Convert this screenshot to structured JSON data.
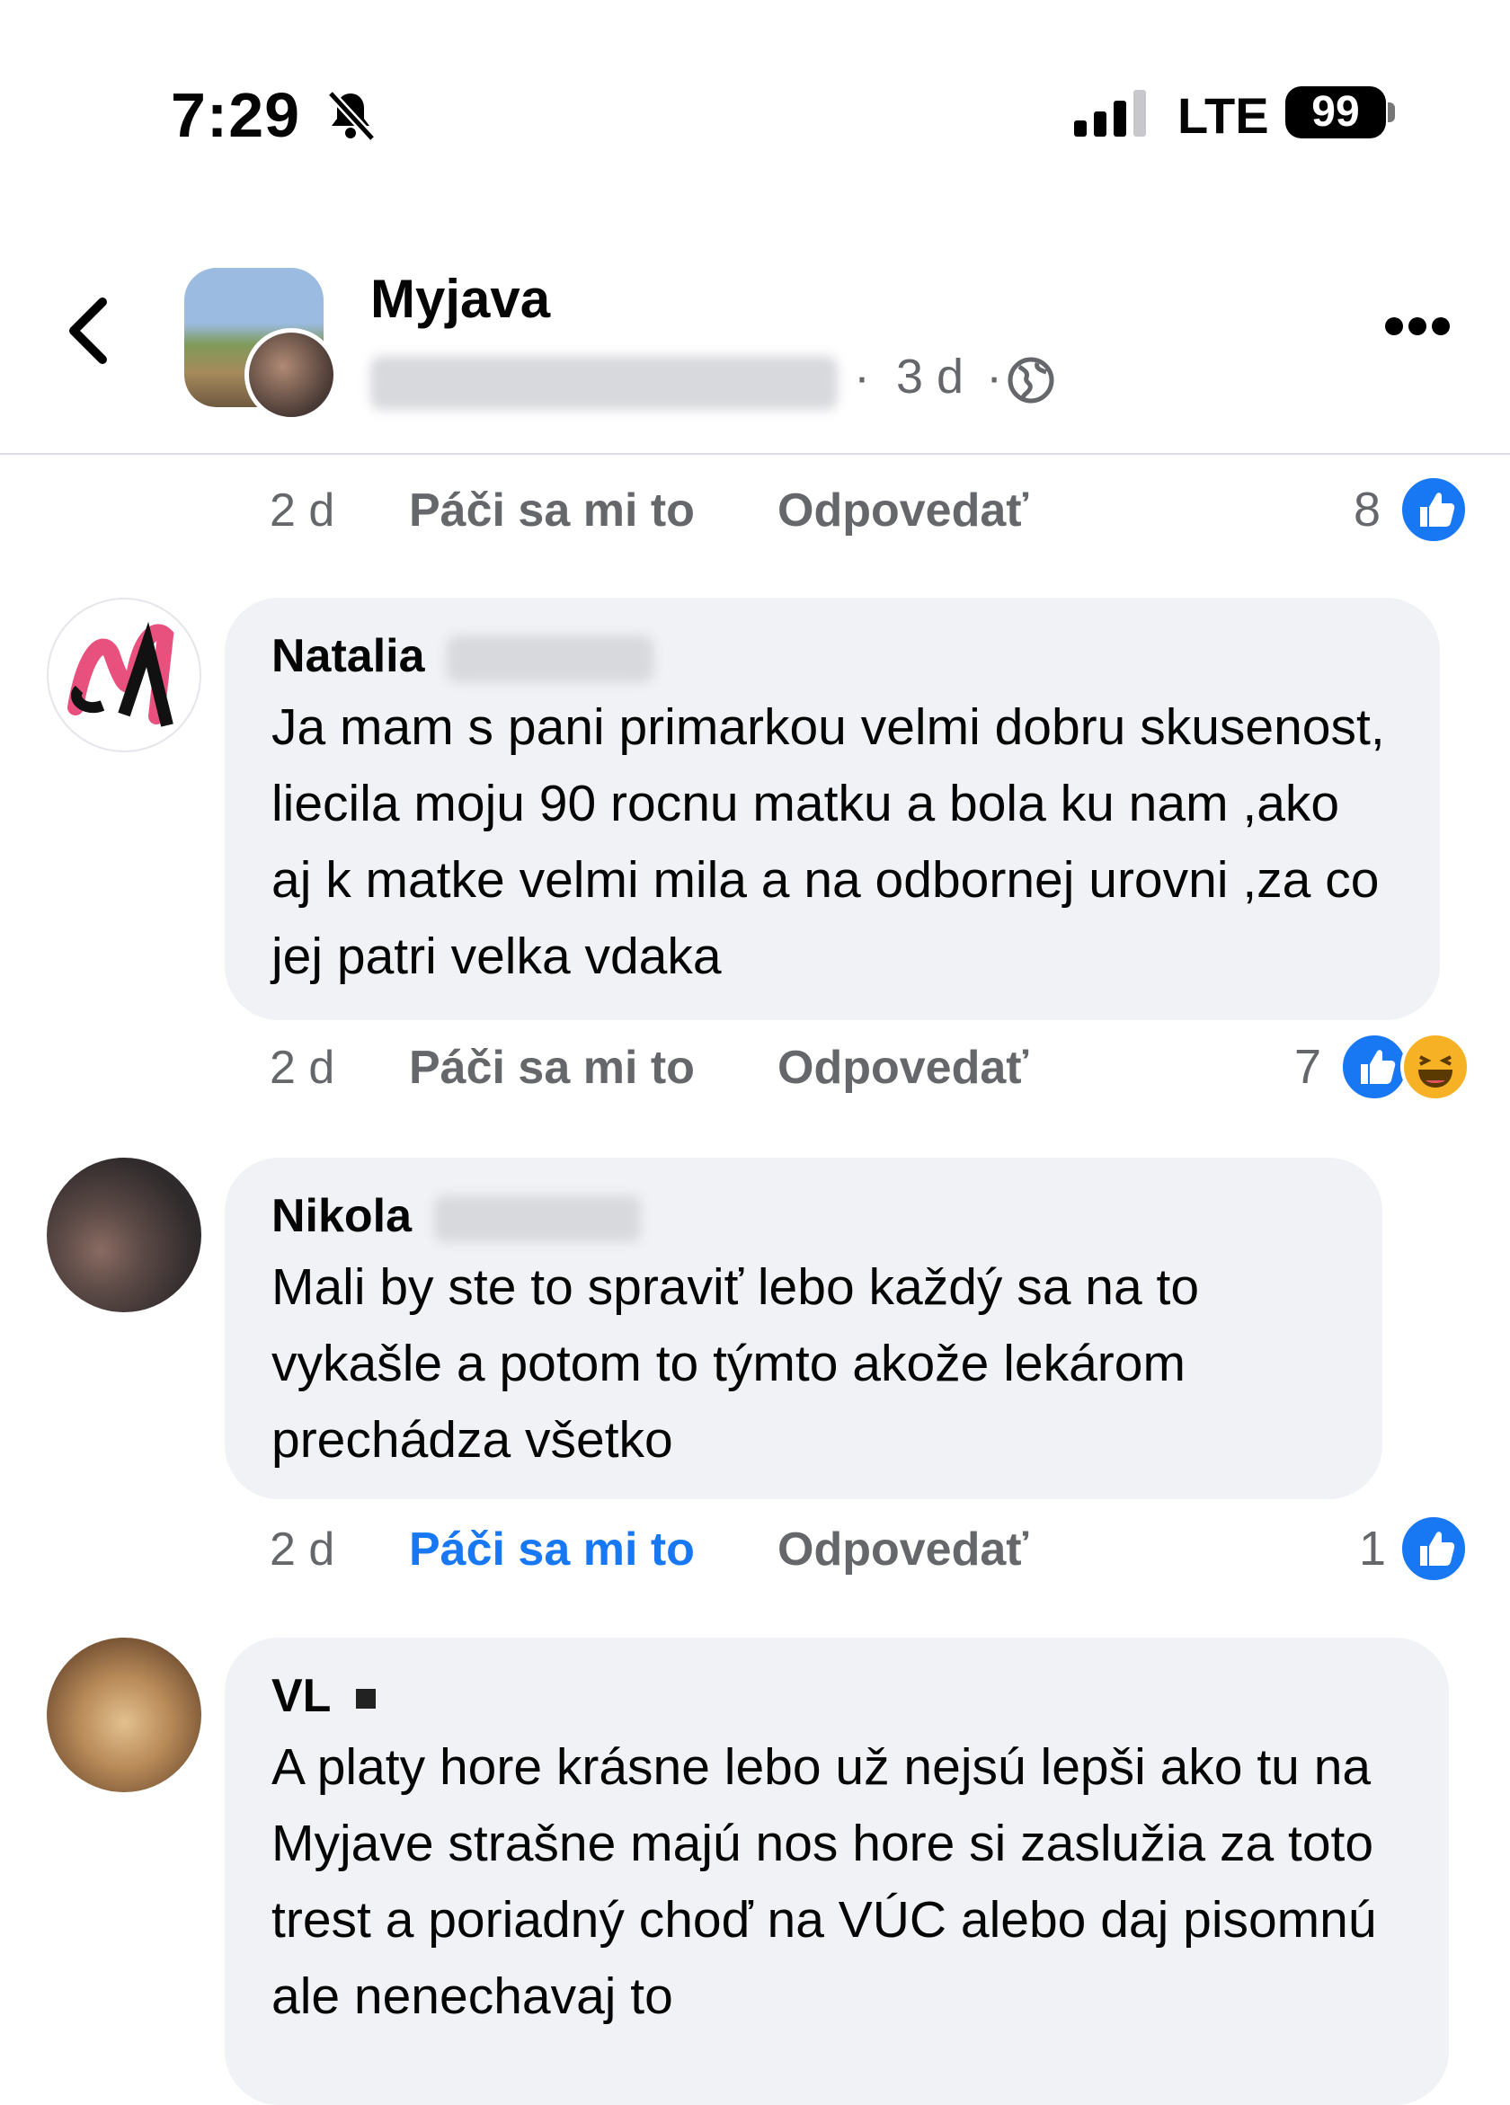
{
  "status": {
    "time": "7:29",
    "network": "LTE",
    "battery": "99"
  },
  "header": {
    "title": "Myjava",
    "age": "3 d",
    "separator": "·"
  },
  "first_actions": {
    "time": "2 d",
    "like": "Páči sa mi to",
    "reply": "Odpovedať",
    "count": "8"
  },
  "comments": [
    {
      "author": "Natalia",
      "text": "Ja mam s pani primarkou velmi dobru skusenost, liecila moju 90 rocnu matku a bola ku nam ,ako aj k matke velmi mila a na odbornej urovni ,za co jej patri velka vdaka",
      "time": "2 d",
      "like": "Páči sa mi to",
      "reply": "Odpovedať",
      "count": "7"
    },
    {
      "author": "Nikola",
      "text": "Mali by ste to spraviť lebo každý sa na to vykašle a potom to týmto akože lekárom prechádza všetko",
      "time": "2 d",
      "like": "Páči sa mi to",
      "reply": "Odpovedať",
      "count": "1"
    },
    {
      "author": "VL",
      "text": "A platy hore krásne  lebo už nejsú lepši ako tu na Myjave strašne majú nos hore  si zaslužia za toto trest a poriadný choď na VÚC alebo daj pisomnú  ale nenechavaj to"
    }
  ],
  "colors": {
    "accent": "#1877f2",
    "bubble": "#f0f2f5",
    "muted": "#65676b"
  },
  "icons": [
    "bell-slash-icon",
    "back-chevron-icon",
    "globe-icon",
    "more-icon",
    "like-icon",
    "haha-icon"
  ]
}
